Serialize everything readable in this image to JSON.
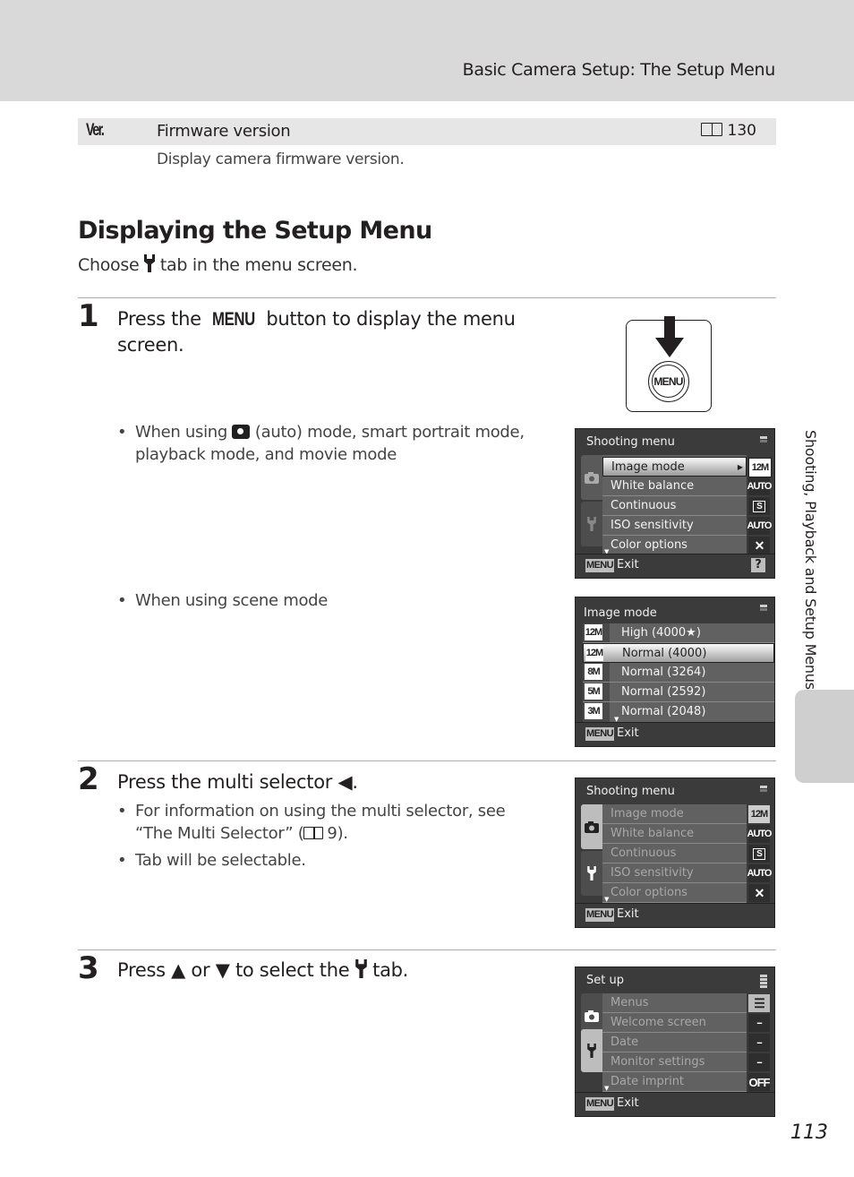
{
  "header": {
    "title": "Basic Camera Setup: The Setup Menu"
  },
  "firmware_row": {
    "icon": "Ver.",
    "icon_name": "version-icon",
    "label": "Firmware version",
    "ref_icon": "book-icon",
    "ref_page": "130",
    "description": "Display camera firmware version."
  },
  "section": {
    "title": "Displaying the Setup Menu",
    "subtitle_pre": "Choose",
    "subtitle_icon": "wrench-icon",
    "subtitle_post": "tab in the menu screen."
  },
  "steps": [
    {
      "number": "1",
      "text_pre": "Press the",
      "text_key": "MENU",
      "text_post": "button to display the menu screen.",
      "bullets": [
        {
          "pre": "When using",
          "icon": "camera-icon",
          "post": "(auto) mode, smart portrait mode, playback mode, and movie mode"
        },
        {
          "text": "When using scene mode"
        }
      ]
    },
    {
      "number": "2",
      "text": "Press the multi selector",
      "text_glyph": "◀",
      "text_end": ".",
      "bullets": [
        {
          "pre": "For information on using the multi selector, see “The Multi Selector” (",
          "ref_icon": "book-icon",
          "post": "9)."
        },
        {
          "text": "Tab will be selectable."
        }
      ]
    },
    {
      "number": "3",
      "text_pre": "Press",
      "glyph_up": "▲",
      "text_or": "or",
      "glyph_down": "▼",
      "text_mid": "to select the",
      "text_icon": "wrench-icon",
      "text_post": "tab."
    }
  ],
  "menu_button_illustration": {
    "label": "MENU",
    "arrow": "down-arrow"
  },
  "screens": [
    {
      "title": "Shooting menu",
      "active_tab": "camera",
      "items": [
        {
          "label": "Image mode",
          "value_icon": "12M",
          "selected": true
        },
        {
          "label": "White balance",
          "value_icon": "AUTO"
        },
        {
          "label": "Continuous",
          "value_icon": "S"
        },
        {
          "label": "ISO sensitivity",
          "value_icon": "AUTO"
        },
        {
          "label": "Color options",
          "value_icon": "color-off"
        }
      ],
      "footer": {
        "menu": "MENU",
        "exit": "Exit",
        "help": "?"
      }
    },
    {
      "title": "Image mode",
      "items": [
        {
          "icon": "12M★",
          "label": "High (4000★)"
        },
        {
          "icon": "12M",
          "label": "Normal (4000)",
          "selected": true
        },
        {
          "icon": "8M",
          "label": "Normal (3264)"
        },
        {
          "icon": "5M",
          "label": "Normal (2592)"
        },
        {
          "icon": "3M",
          "label": "Normal (2048)"
        }
      ],
      "footer": {
        "menu": "MENU",
        "exit": "Exit"
      }
    },
    {
      "title": "Shooting menu",
      "active_tab": "camera-selectable",
      "items": [
        {
          "label": "Image mode",
          "value_icon": "12M"
        },
        {
          "label": "White balance",
          "value_icon": "AUTO"
        },
        {
          "label": "Continuous",
          "value_icon": "S"
        },
        {
          "label": "ISO sensitivity",
          "value_icon": "AUTO"
        },
        {
          "label": "Color options",
          "value_icon": "color-off"
        }
      ],
      "footer": {
        "menu": "MENU",
        "exit": "Exit"
      }
    },
    {
      "title": "Set up",
      "active_tab": "wrench",
      "items": [
        {
          "label": "Menus",
          "value_icon": "list"
        },
        {
          "label": "Welcome screen",
          "value_icon": "--"
        },
        {
          "label": "Date",
          "value_icon": "--"
        },
        {
          "label": "Monitor settings",
          "value_icon": "--"
        },
        {
          "label": "Date imprint",
          "value_icon": "OFF"
        }
      ],
      "footer": {
        "menu": "MENU",
        "exit": "Exit"
      }
    }
  ],
  "side_tab": {
    "text": "Shooting, Playback and Setup Menus"
  },
  "page_number": "113"
}
